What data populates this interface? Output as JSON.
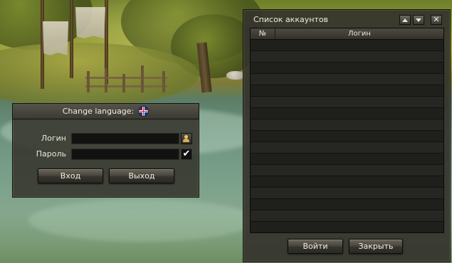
{
  "login_panel": {
    "header_label": "Change language:",
    "flag_icon": "uk-flag-icon",
    "login_label": "Логин",
    "login_value": "",
    "password_label": "Пароль",
    "password_value": "",
    "remember_checked": true,
    "remember_mark": "✔",
    "enter_button": "Вход",
    "exit_button": "Выход"
  },
  "accounts_panel": {
    "title": "Список аккаунтов",
    "scroll_up_icon": "arrow-up-icon",
    "scroll_down_icon": "arrow-down-icon",
    "close_label": "✕",
    "columns": [
      "№",
      "Логин"
    ],
    "rows": [],
    "login_button": "Войти",
    "close_button": "Закрыть"
  },
  "colors": {
    "panel_bg": "#34322a",
    "button_text": "#f2eee2"
  }
}
